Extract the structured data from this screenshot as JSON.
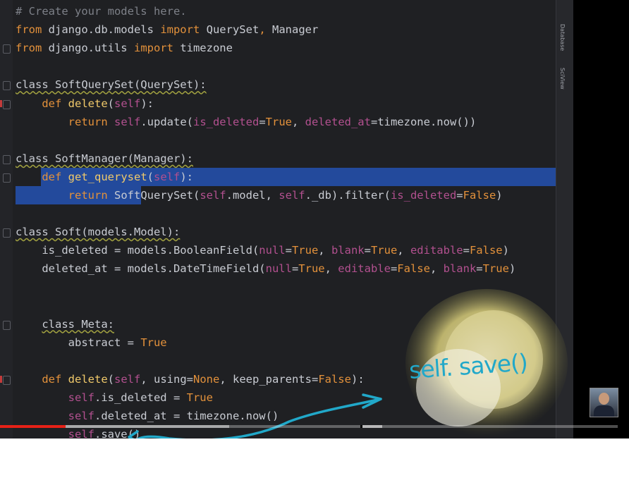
{
  "editor": {
    "lines": [
      {
        "tokens": [
          {
            "t": "# Create your models here.",
            "c": "cm"
          }
        ]
      },
      {
        "tokens": [
          {
            "t": "from",
            "c": "kw"
          },
          {
            "t": " django.db.models "
          },
          {
            "t": "import",
            "c": "kw"
          },
          {
            "t": " QuerySet"
          },
          {
            "t": ",",
            "c": "kw"
          },
          {
            "t": " Manager"
          }
        ]
      },
      {
        "tokens": [
          {
            "t": "from",
            "c": "kw"
          },
          {
            "t": " django.utils "
          },
          {
            "t": "import",
            "c": "kw"
          },
          {
            "t": " timezone"
          }
        ]
      },
      {
        "tokens": []
      },
      {
        "tokens": [
          {
            "t": "class SoftQuerySet(QuerySet):",
            "c": "cls"
          }
        ]
      },
      {
        "tokens": [
          {
            "t": "    "
          },
          {
            "t": "def",
            "c": "kw"
          },
          {
            "t": " "
          },
          {
            "t": "delete",
            "c": "fn"
          },
          {
            "t": "("
          },
          {
            "t": "self",
            "c": "self"
          },
          {
            "t": "):"
          }
        ]
      },
      {
        "tokens": [
          {
            "t": "        "
          },
          {
            "t": "return",
            "c": "kw"
          },
          {
            "t": " "
          },
          {
            "t": "self",
            "c": "self"
          },
          {
            "t": ".update("
          },
          {
            "t": "is_deleted",
            "c": "param"
          },
          {
            "t": "="
          },
          {
            "t": "True",
            "c": "bool"
          },
          {
            "t": ", "
          },
          {
            "t": "deleted_at",
            "c": "param"
          },
          {
            "t": "=timezone.now())"
          }
        ]
      },
      {
        "tokens": []
      },
      {
        "tokens": [
          {
            "t": "class SoftManager(Manager):",
            "c": "cls"
          }
        ]
      },
      {
        "tokens": [
          {
            "t": "    "
          },
          {
            "t": "def",
            "c": "kw"
          },
          {
            "t": " "
          },
          {
            "t": "get_queryset",
            "c": "fn"
          },
          {
            "t": "("
          },
          {
            "t": "self",
            "c": "self"
          },
          {
            "t": "):"
          }
        ]
      },
      {
        "tokens": [
          {
            "t": "        "
          },
          {
            "t": "return",
            "c": "kw"
          },
          {
            "t": " SoftQuerySet("
          },
          {
            "t": "self",
            "c": "self"
          },
          {
            "t": ".model, "
          },
          {
            "t": "self",
            "c": "self"
          },
          {
            "t": "._db).filter("
          },
          {
            "t": "is_deleted",
            "c": "param"
          },
          {
            "t": "="
          },
          {
            "t": "False",
            "c": "bool"
          },
          {
            "t": ")"
          }
        ]
      },
      {
        "tokens": []
      },
      {
        "tokens": [
          {
            "t": "class Soft(models.Model):",
            "c": "cls"
          }
        ]
      },
      {
        "tokens": [
          {
            "t": "    is_deleted = models.BooleanField("
          },
          {
            "t": "null",
            "c": "param"
          },
          {
            "t": "="
          },
          {
            "t": "True",
            "c": "bool"
          },
          {
            "t": ", "
          },
          {
            "t": "blank",
            "c": "param"
          },
          {
            "t": "="
          },
          {
            "t": "True",
            "c": "bool"
          },
          {
            "t": ", "
          },
          {
            "t": "editable",
            "c": "param"
          },
          {
            "t": "="
          },
          {
            "t": "False",
            "c": "bool"
          },
          {
            "t": ")"
          }
        ]
      },
      {
        "tokens": [
          {
            "t": "    deleted_at = models.DateTimeField("
          },
          {
            "t": "null",
            "c": "param"
          },
          {
            "t": "="
          },
          {
            "t": "True",
            "c": "bool"
          },
          {
            "t": ", "
          },
          {
            "t": "editable",
            "c": "param"
          },
          {
            "t": "="
          },
          {
            "t": "False",
            "c": "bool"
          },
          {
            "t": ", "
          },
          {
            "t": "blank",
            "c": "param"
          },
          {
            "t": "="
          },
          {
            "t": "True",
            "c": "bool"
          },
          {
            "t": ")"
          }
        ]
      },
      {
        "tokens": []
      },
      {
        "tokens": []
      },
      {
        "tokens": [
          {
            "t": "    "
          },
          {
            "t": "class Meta:",
            "c": "cls"
          }
        ]
      },
      {
        "tokens": [
          {
            "t": "        abstract = "
          },
          {
            "t": "True",
            "c": "bool"
          }
        ]
      },
      {
        "tokens": []
      },
      {
        "tokens": [
          {
            "t": "    "
          },
          {
            "t": "def",
            "c": "kw"
          },
          {
            "t": " "
          },
          {
            "t": "delete",
            "c": "fn"
          },
          {
            "t": "("
          },
          {
            "t": "self",
            "c": "self"
          },
          {
            "t": ", using="
          },
          {
            "t": "None",
            "c": "bool"
          },
          {
            "t": ", keep_parents="
          },
          {
            "t": "False",
            "c": "bool"
          },
          {
            "t": "):"
          }
        ]
      },
      {
        "tokens": [
          {
            "t": "        "
          },
          {
            "t": "self",
            "c": "self"
          },
          {
            "t": ".is_deleted = "
          },
          {
            "t": "True",
            "c": "bool"
          }
        ]
      },
      {
        "tokens": [
          {
            "t": "        "
          },
          {
            "t": "self",
            "c": "self"
          },
          {
            "t": ".deleted_at = timezone.now()"
          }
        ]
      },
      {
        "tokens": [
          {
            "t": "        "
          },
          {
            "t": "self",
            "c": "self"
          },
          {
            "t": ".save()"
          }
        ]
      }
    ],
    "selected_lines": [
      9,
      10
    ]
  },
  "side_tabs": [
    "Database",
    "SciView"
  ],
  "annotation": {
    "handwritten_text": "self. save()",
    "color": "#21a8c9"
  },
  "player": {
    "played_fraction": 0.104,
    "loaded_fraction": 0.364
  },
  "colors": {
    "editor_bg": "#1f2023",
    "keyword": "#e3913b",
    "function": "#f0c96a",
    "self": "#b2508f",
    "selection": "#234a9c"
  }
}
